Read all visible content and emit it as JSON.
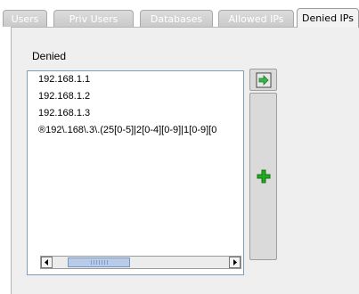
{
  "tabs": [
    {
      "label": "Users",
      "active": false
    },
    {
      "label": "Priv Users",
      "active": false
    },
    {
      "label": "Databases",
      "active": false
    },
    {
      "label": "Allowed IPs",
      "active": false
    },
    {
      "label": "Denied IPs",
      "active": true
    }
  ],
  "denied": {
    "label": "Denied",
    "items": [
      "192.168.1.1",
      "192.168.1.2",
      "192.168.1.3",
      "®192\\.168\\.3\\.(25[0-5]|2[0-4][0-9]|1[0-9][0"
    ]
  },
  "buttons": {
    "top_icon": "export-arrow-icon",
    "add_icon": "green-plus-icon"
  },
  "colors": {
    "accent_green": "#22aa22",
    "scroll_thumb": "#b8cbe9"
  }
}
